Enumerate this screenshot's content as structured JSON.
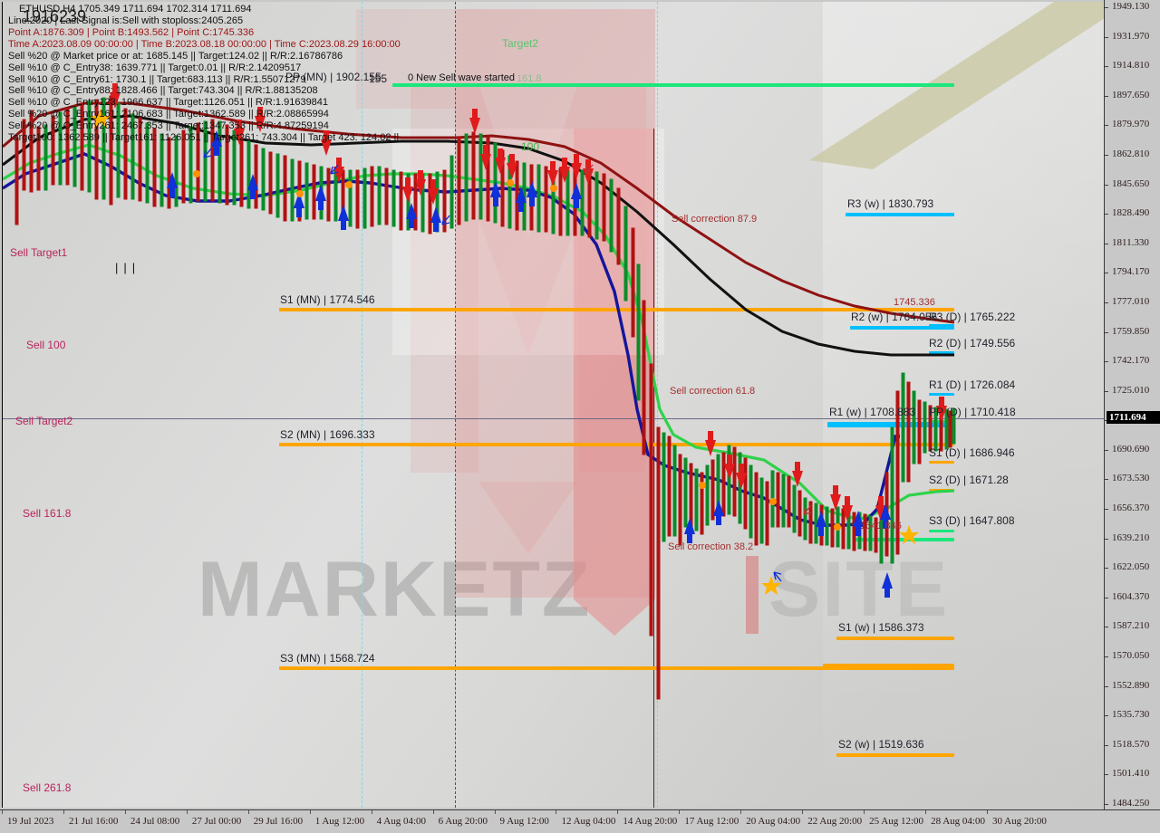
{
  "chart_data": {
    "type": "line",
    "title": "ETHUSD,H4 1705.349 1711.694 1702.314 1711.694",
    "xlabel": "",
    "ylabel": "",
    "ylim": [
      1484.25,
      1949.13
    ],
    "grid": false,
    "legend": "none",
    "y_ticks": [
      "1949.130",
      "1931.970",
      "1914.810",
      "1897.650",
      "1879.970",
      "1862.810",
      "1845.650",
      "1828.490",
      "1811.330",
      "1794.170",
      "1777.010",
      "1759.850",
      "1742.170",
      "1725.010",
      "1707.850",
      "1690.690",
      "1673.530",
      "1656.370",
      "1639.210",
      "1622.050",
      "1604.370",
      "1587.210",
      "1570.050",
      "1552.890",
      "1535.730",
      "1518.570",
      "1501.410",
      "1484.250"
    ],
    "x_ticks": [
      "19 Jul 2023",
      "21 Jul 16:00",
      "24 Jul 08:00",
      "27 Jul 00:00",
      "29 Jul 16:00",
      "1 Aug 12:00",
      "4 Aug 04:00",
      "6 Aug 20:00",
      "9 Aug 12:00",
      "12 Aug 04:00",
      "14 Aug 20:00",
      "17 Aug 12:00",
      "20 Aug 04:00",
      "22 Aug 20:00",
      "25 Aug 12:00",
      "28 Aug 04:00",
      "30 Aug 20:00"
    ],
    "current_price": "1711.694",
    "series": [
      {
        "name": "MA dark-red",
        "color": "#8f1212"
      },
      {
        "name": "MA black",
        "color": "#111111"
      },
      {
        "name": "MA green",
        "color": "#2fd24a"
      },
      {
        "name": "MA navy",
        "color": "#15159b"
      }
    ]
  },
  "header": {
    "symbol_line": "ETHUSD,H4 1705.349 1711.694 1702.314 1711.694",
    "scale_value": "1916239",
    "lines": [
      "Line:2020 | Last Signal is:Sell with stoploss:2405.265",
      "Point A:1876.309 | Point B:1493.562 | Point C:1745.336",
      "Time A:2023.08.09 00:00:00 | Time B:2023.08.18 00:00:00 | Time C:2023.08.29 16:00:00",
      "Sell %20 @ Market price or at: 1685.145 || Target:124.02 || R/R:2.16786786",
      "Sell %10 @ C_Entry38: 1639.771 || Target:0.01 || R/R:2.14209517",
      "Sell %10 @ C_Entry61: 1730.1 || Target:683.113 || R/R:1.55071279",
      "Sell %10 @ C_Entry88: 1828.466 || Target:743.304 || R/R:1.88135208",
      "Sell %10 @ C_Entry123: 1966.637 || Target:1126.051 || R/R:1.91639841",
      "Sell %20 @ C_Entry161: 2106.683 || Target:1362.589 || R/R:2.08865994",
      "Sell %20 @ C_Entry261: 2467.353 || Target:1347.353 || R/R:4.87259194",
      "Target100: 1362.589 || Target161: 1126.051 || Target261: 743.304 || Target 423: 124.02 ||"
    ],
    "header_colors": {
      "accent_red": "#9b1414",
      "ink": "#101010"
    }
  },
  "left_labels": [
    {
      "text": "Sell Target1",
      "color": "#b8245e"
    },
    {
      "text": "Sell 100",
      "color": "#b8245e"
    },
    {
      "text": "Sell Target2",
      "color": "#b8245e"
    },
    {
      "text": "Sell 161.8",
      "color": "#b8245e"
    },
    {
      "text": "Sell  261.8",
      "color": "#b8245e"
    }
  ],
  "chart_annotations": [
    {
      "text": "Target2",
      "color": "#57c46e"
    },
    {
      "text": "0 New Sell wave started",
      "color": "#101010"
    },
    {
      "text": "161.8",
      "color": "#8fbf8f"
    },
    {
      "text": "100",
      "color": "#3cb54a"
    },
    {
      "text": "Sell correction 87.9",
      "color": "#a33030"
    },
    {
      "text": "Sell correction 61.8",
      "color": "#a33030"
    },
    {
      "text": "Sell correction 38.2",
      "color": "#a33030"
    },
    {
      "text": "1745.336",
      "color": "#a33030"
    },
    {
      "text": "1641.846",
      "color": "#a33030"
    },
    {
      "text": "155",
      "color": "#22222c"
    }
  ],
  "pivot_levels": [
    {
      "label": "PP (MN) | 1902.155",
      "color": "#1be77a",
      "group": "MN"
    },
    {
      "label": "S1 (MN) | 1774.546",
      "color": "#ffa500",
      "group": "MN"
    },
    {
      "label": "S2 (MN) | 1696.333",
      "color": "#ffa500",
      "group": "MN"
    },
    {
      "label": "S3 (MN) | 1568.724",
      "color": "#ffa500",
      "group": "MN"
    },
    {
      "label": "R3 (w) | 1830.793",
      "color": "#00bfff",
      "group": "W"
    },
    {
      "label": "R2 (w) | 1764.056",
      "color": "#00bfff",
      "group": "W"
    },
    {
      "label": "R1 (w) | 1708.883",
      "color": "#00bfff",
      "group": "W"
    },
    {
      "label": "S1 (w) | 1586.373",
      "color": "#ffa500",
      "group": "W"
    },
    {
      "label": "S2 (w) | 1519.636",
      "color": "#ffa500",
      "group": "W"
    },
    {
      "label": "R3 (D) | 1765.222",
      "color": "#00bfff",
      "group": "D"
    },
    {
      "label": "R2 (D) | 1749.556",
      "color": "#00bfff",
      "group": "D"
    },
    {
      "label": "R1 (D) | 1726.084",
      "color": "#00bfff",
      "group": "D"
    },
    {
      "label": "PP (D) | 1710.418",
      "color": "#1be77a",
      "group": "D"
    },
    {
      "label": "S1 (D) | 1686.946",
      "color": "#ffa500",
      "group": "D"
    },
    {
      "label": "S2 (D) | 1671.28",
      "color": "#ffa500",
      "group": "D"
    },
    {
      "label": "S3 (D) | 1647.808",
      "color": "#1be77a",
      "group": "D"
    }
  ],
  "watermark": {
    "brand": "MARKETZ",
    "suffix": "SITE"
  }
}
